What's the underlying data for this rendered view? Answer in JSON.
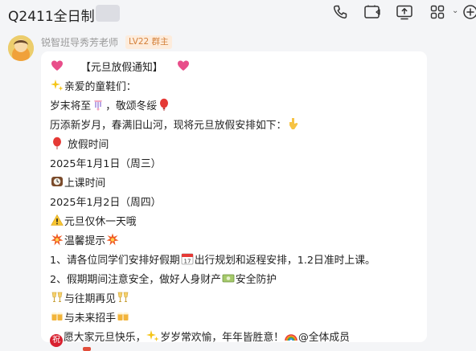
{
  "header": {
    "title": "Q2411全日制",
    "icons": [
      "phone-icon",
      "video-icon",
      "screen-share-icon",
      "apps-grid-icon",
      "chevron-down-icon",
      "add-icon"
    ]
  },
  "message": {
    "sender": "锐智班导秀芳老师",
    "badge": "LV22 群主",
    "lines": [
      "【元旦放假通知】",
      "亲爱的童鞋们：",
      "岁末将至",
      "，敬颂冬绥",
      "历添新岁月，春满旧山河，现将元旦放假安排如下：",
      "放假时间",
      "2025年1月1日（周三）",
      "上课时间",
      "2025年1月2日（周四）",
      "元旦仅休一天哦",
      "温馨提示",
      "1、请各位同学们安排好假期",
      "出行规划和返程安排，1.2日准时上课。",
      "2、假期期间注意安全，做好人身财产",
      "安全防护",
      "与往期再见",
      "与未来招手",
      "愿大家元旦快乐，",
      "岁岁常欢愉，年年皆胜意！",
      "@全体成员"
    ],
    "calendar_day": "17",
    "wish_char": "祝"
  },
  "colors": {
    "badge_text": "#d4803a",
    "badge_bg": "#fdecdc",
    "bubble_bg": "#ffffff",
    "page_bg": "#f4f5f7"
  }
}
